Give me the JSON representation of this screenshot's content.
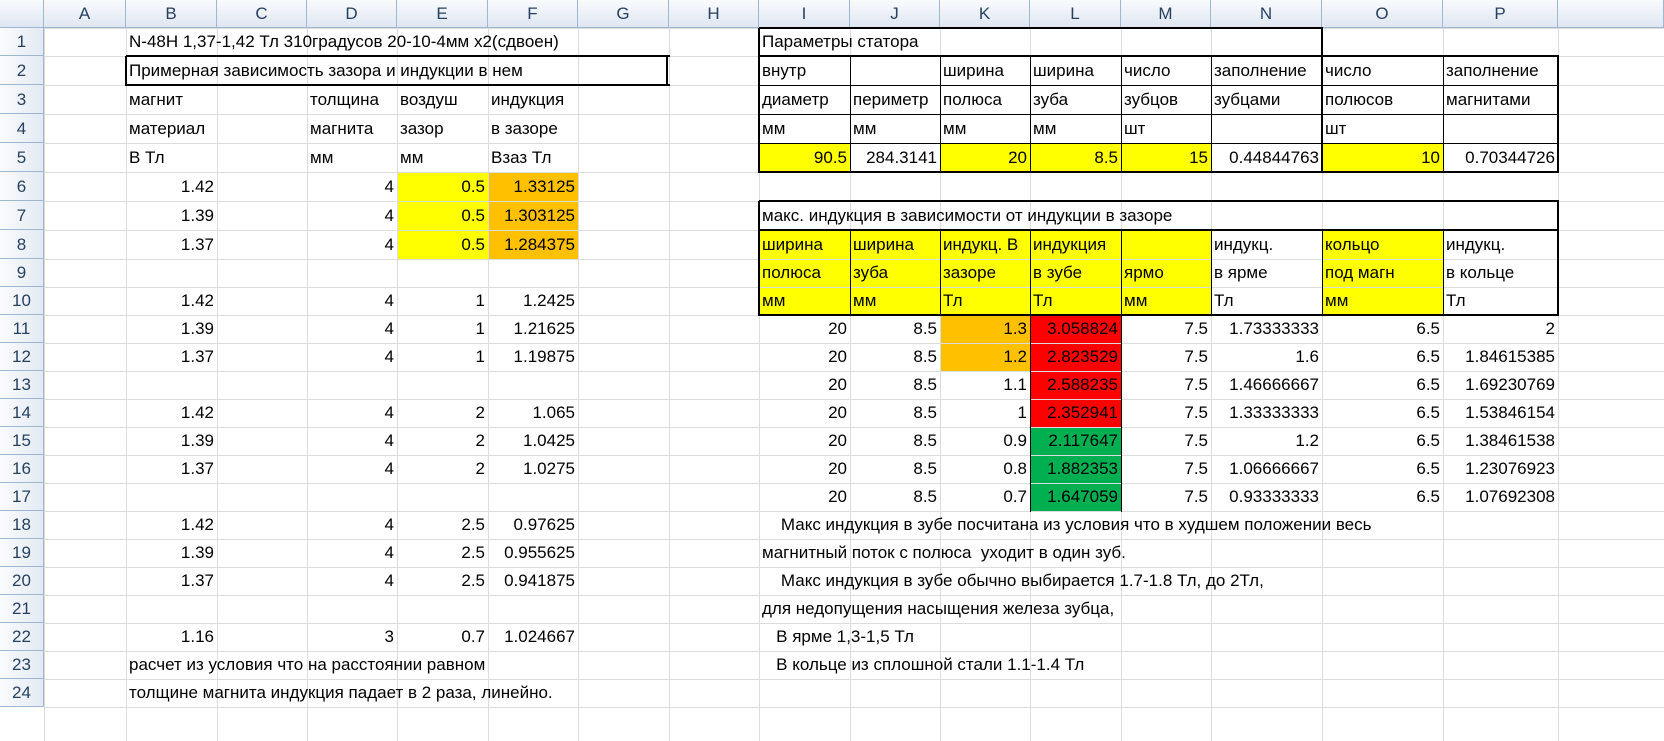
{
  "columns": [
    "A",
    "B",
    "C",
    "D",
    "E",
    "F",
    "G",
    "H",
    "I",
    "J",
    "K",
    "L",
    "M",
    "N",
    "O",
    "P"
  ],
  "rows": [
    "1",
    "2",
    "3",
    "4",
    "5",
    "6",
    "7",
    "8",
    "9",
    "10",
    "11",
    "12",
    "13",
    "14",
    "15",
    "16",
    "17",
    "18",
    "19",
    "20",
    "21",
    "22",
    "23",
    "24"
  ],
  "colors": {
    "yellow": "#ffff00",
    "orange": "#ffc000",
    "red": "#ff0000",
    "green": "#00b050",
    "gridline": "#dadcdd",
    "header_bg": "#e4eaf3"
  },
  "left": {
    "title": "N-48H  1,37-1,42 Тл  310градусов  20-10-4мм х2(сдвоен)",
    "subtitle": "Примерная зависимость зазора и индукции в нем",
    "headers": [
      [
        "магнит",
        "толщина",
        "воздуш",
        "индукция"
      ],
      [
        "материал",
        "магнита",
        "зазор",
        "в зазоре"
      ],
      [
        "В Тл",
        "мм",
        "мм",
        "Взаз Тл"
      ]
    ],
    "rows": [
      [
        "1.42",
        "4",
        "0.5",
        "1.33125"
      ],
      [
        "1.39",
        "4",
        "0.5",
        "1.303125"
      ],
      [
        "1.37",
        "4",
        "0.5",
        "1.284375"
      ],
      [
        "",
        "",
        "",
        ""
      ],
      [
        "1.42",
        "4",
        "1",
        "1.2425"
      ],
      [
        "1.39",
        "4",
        "1",
        "1.21625"
      ],
      [
        "1.37",
        "4",
        "1",
        "1.19875"
      ],
      [
        "",
        "",
        "",
        ""
      ],
      [
        "1.42",
        "4",
        "2",
        "1.065"
      ],
      [
        "1.39",
        "4",
        "2",
        "1.0425"
      ],
      [
        "1.37",
        "4",
        "2",
        "1.0275"
      ],
      [
        "",
        "",
        "",
        ""
      ],
      [
        "1.42",
        "4",
        "2.5",
        "0.97625"
      ],
      [
        "1.39",
        "4",
        "2.5",
        "0.955625"
      ],
      [
        "1.37",
        "4",
        "2.5",
        "0.941875"
      ],
      [
        "",
        "",
        "",
        ""
      ],
      [
        "1.16",
        "3",
        "0.7",
        "1.024667"
      ]
    ],
    "note1": "расчет из условия что на расстоянии равном",
    "note2": "толщине магнита индукция падает в 2 раза, линейно."
  },
  "stator": {
    "title": "Параметры статора",
    "headers": [
      [
        "внутр",
        "",
        "ширина",
        "ширина",
        "число",
        "заполнение",
        "число",
        "заполнение"
      ],
      [
        "диаметр",
        "периметр",
        "полюса",
        "зуба",
        "зубцов",
        "зубцами",
        "полюсов",
        "магнитами"
      ],
      [
        "мм",
        "мм",
        "мм",
        "мм",
        "шт",
        "",
        "шт",
        ""
      ]
    ],
    "values": [
      "90.5",
      "284.3141",
      "20",
      "8.5",
      "15",
      "0.44844763",
      "10",
      "0.70344726"
    ]
  },
  "induction": {
    "title": "макс. индукция в зависимости от индукции в зазоре",
    "headers": [
      [
        "ширина",
        "ширина",
        "индукц. В",
        "индукция",
        "",
        "индукц.",
        "кольцо",
        "индукц."
      ],
      [
        "полюса",
        "зуба",
        "зазоре",
        "в зубе",
        "ярмо",
        "в ярме",
        "под магн",
        "в кольце"
      ],
      [
        "мм",
        "мм",
        "Тл",
        "Тл",
        "мм",
        "Тл",
        "мм",
        "Тл"
      ]
    ],
    "rows": [
      [
        "20",
        "8.5",
        "1.3",
        "3.058824",
        "7.5",
        "1.73333333",
        "6.5",
        "2"
      ],
      [
        "20",
        "8.5",
        "1.2",
        "2.823529",
        "7.5",
        "1.6",
        "6.5",
        "1.84615385"
      ],
      [
        "20",
        "8.5",
        "1.1",
        "2.588235",
        "7.5",
        "1.46666667",
        "6.5",
        "1.69230769"
      ],
      [
        "20",
        "8.5",
        "1",
        "2.352941",
        "7.5",
        "1.33333333",
        "6.5",
        "1.53846154"
      ],
      [
        "20",
        "8.5",
        "0.9",
        "2.117647",
        "7.5",
        "1.2",
        "6.5",
        "1.38461538"
      ],
      [
        "20",
        "8.5",
        "0.8",
        "1.882353",
        "7.5",
        "1.06666667",
        "6.5",
        "1.23076923"
      ],
      [
        "20",
        "8.5",
        "0.7",
        "1.647059",
        "7.5",
        "0.93333333",
        "6.5",
        "1.07692308"
      ]
    ],
    "tooth_colors": [
      "red",
      "red",
      "red",
      "red",
      "green",
      "green",
      "green"
    ],
    "gap_colors": [
      "orange",
      "orange",
      "",
      "",
      "",
      "",
      ""
    ],
    "notes": [
      "    Макс индукция в зубе посчитана из условия что в худшем положении весь",
      "магнитный поток с полюса  уходит в один зуб.",
      "    Макс индукция в зубе обычно выбирается 1.7-1.8 Тл, до 2Тл,",
      "для недопущения насыщения железа зубца,",
      "   В ярме 1,3-1,5 Тл",
      "   В кольце из сплошной стали 1.1-1.4 Тл"
    ]
  }
}
